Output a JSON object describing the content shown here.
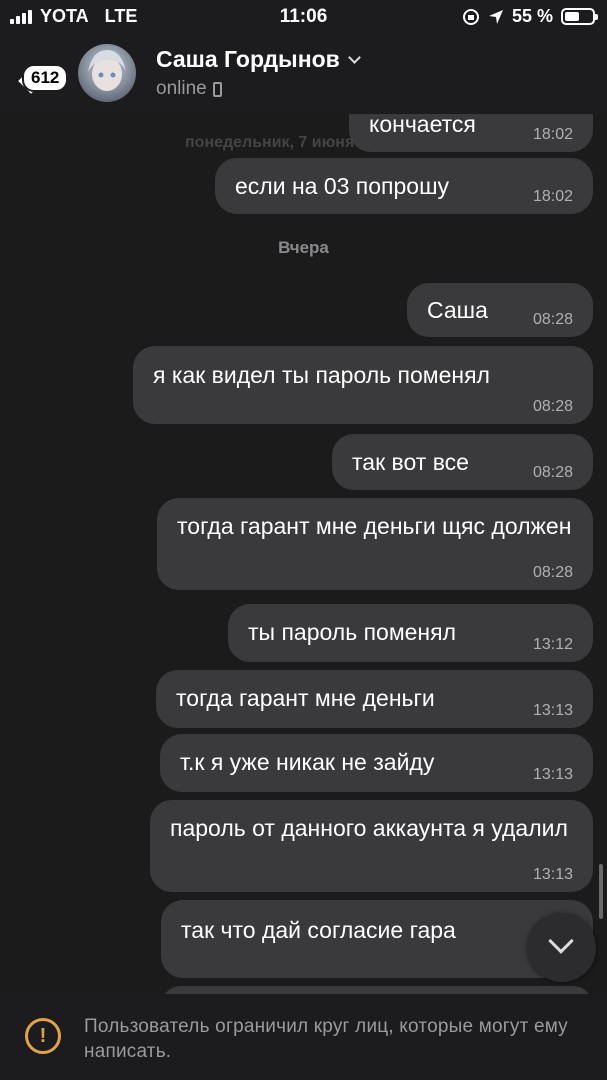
{
  "status_bar": {
    "carrier": "YOTA",
    "network": "LTE",
    "time": "11:06",
    "battery": "55 %",
    "battery_level": 0.55
  },
  "header": {
    "unread_badge": "612",
    "name": "Саша Гордынов",
    "status": "online"
  },
  "chat": {
    "date_overlay": "понедельник, 7 июня",
    "date_separator": "Вчера",
    "messages": [
      {
        "text": "кончается",
        "time": "18:02"
      },
      {
        "text": "если на 03 попрошу",
        "time": "18:02"
      },
      {
        "text": "Саша",
        "time": "08:28"
      },
      {
        "text": "я как видел ты пароль поменял",
        "time": "08:28"
      },
      {
        "text": "так вот все",
        "time": "08:28"
      },
      {
        "text": "тогда гарант мне деньги щяс должен",
        "time": "08:28"
      },
      {
        "text": "ты пароль поменял",
        "time": "13:12"
      },
      {
        "text": "тогда гарант мне деньги",
        "time": "13:13"
      },
      {
        "text": "т.к я уже никак не зайду",
        "time": "13:13"
      },
      {
        "text": "пароль от данного аккаунта я удалил",
        "time": "13:13"
      },
      {
        "text": "так что дай согласие гара",
        "time": ""
      }
    ]
  },
  "footer": {
    "notice": "Пользователь ограничил круг лиц, которые могут ему написать."
  }
}
